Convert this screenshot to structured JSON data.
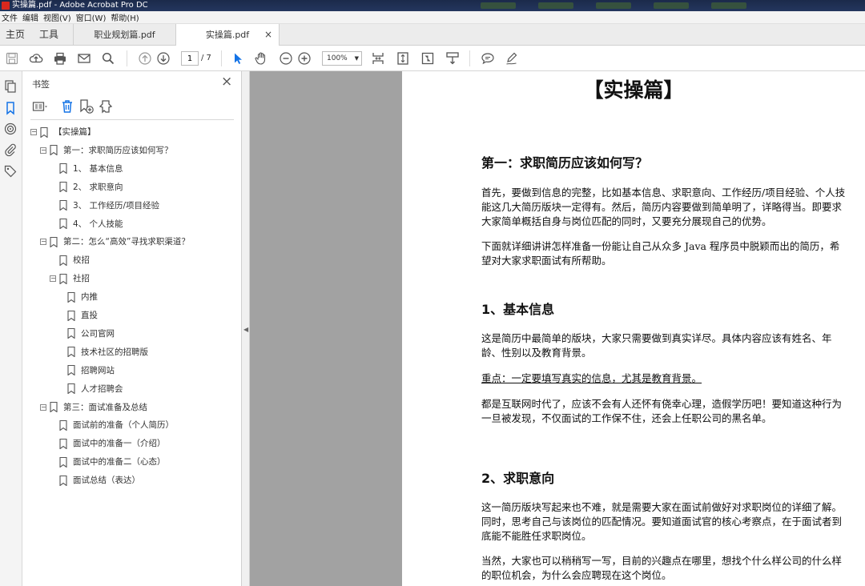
{
  "window": {
    "title": "实操篇.pdf - Adobe Acrobat Pro DC"
  },
  "menu": [
    "文件",
    "编辑",
    "视图(V)",
    "窗口(W)",
    "帮助(H)"
  ],
  "tabs": {
    "home": "主页",
    "tools": "工具",
    "documents": [
      {
        "label": "职业规划篇.pdf",
        "active": false
      },
      {
        "label": "实操篇.pdf",
        "active": true
      }
    ],
    "close": "×"
  },
  "toolbar": {
    "page_current": "1",
    "page_total": "/ 7",
    "zoom": "100%",
    "icons": [
      "save-icon",
      "upload-icon",
      "print-icon",
      "mail-icon",
      "search-icon",
      "page-up-icon",
      "page-down-icon",
      "select-cursor-icon",
      "hand-icon",
      "zoom-out-icon",
      "zoom-in-icon",
      "fit-width-icon",
      "fit-page-icon",
      "full-screen-icon",
      "scroll-mode-icon",
      "comment-icon",
      "pen-icon"
    ]
  },
  "bookmarks": {
    "title": "书签",
    "close": "×",
    "items": [
      {
        "label": "【实操篇】",
        "level": 0,
        "toggle": "−"
      },
      {
        "label": "第一：求职简历应该如何写？",
        "level": 1,
        "toggle": "−"
      },
      {
        "label": "1、 基本信息",
        "level": 2,
        "toggle": ""
      },
      {
        "label": "2、 求职意向",
        "level": 2,
        "toggle": ""
      },
      {
        "label": "3、 工作经历/项目经验",
        "level": 2,
        "toggle": ""
      },
      {
        "label": "4、 个人技能",
        "level": 2,
        "toggle": ""
      },
      {
        "label": "第二：怎么“高效”寻找求职渠道？",
        "level": 1,
        "toggle": "−"
      },
      {
        "label": "校招",
        "level": 2,
        "toggle": ""
      },
      {
        "label": "社招",
        "level": 2,
        "toggle": "−"
      },
      {
        "label": "内推",
        "level": 3,
        "toggle": ""
      },
      {
        "label": "直投",
        "level": 3,
        "toggle": ""
      },
      {
        "label": "公司官网",
        "level": 3,
        "toggle": ""
      },
      {
        "label": "技术社区的招聘版",
        "level": 3,
        "toggle": ""
      },
      {
        "label": "招聘网站",
        "level": 3,
        "toggle": ""
      },
      {
        "label": "人才招聘会",
        "level": 3,
        "toggle": ""
      },
      {
        "label": "第三：面试准备及总结",
        "level": 1,
        "toggle": "−"
      },
      {
        "label": "面试前的准备（个人简历）",
        "level": 2,
        "toggle": ""
      },
      {
        "label": "面试中的准备一（介绍）",
        "level": 2,
        "toggle": ""
      },
      {
        "label": "面试中的准备二（心态）",
        "level": 2,
        "toggle": ""
      },
      {
        "label": "面试总结（表达）",
        "level": 2,
        "toggle": ""
      }
    ]
  },
  "document": {
    "title": "【实操篇】",
    "h_section1": "第一：求职简历应该如何写？",
    "p1": "首先，要做到信息的完整，比如基本信息、求职意向、工作经历/项目经验、个人技能这几大简历版块一定得有。然后，简历内容要做到简单明了，详略得当。即要求大家简单概括自身与岗位匹配的同时，又要充分展现自己的优势。",
    "p2": "下面就详细讲讲怎样准备一份能让自己从众多 Java 程序员中脱颖而出的简历，希望对大家求职面试有所帮助。",
    "h_basic": "1、基本信息",
    "p3": "这是简历中最简单的版块，大家只需要做到真实详尽。具体内容应该有姓名、年龄、性别以及教育背景。",
    "p4": "重点：一定要填写真实的信息，尤其是教育背景。",
    "p5": "都是互联网时代了，应该不会有人还怀有侥幸心理，造假学历吧！要知道这种行为一旦被发现，不仅面试的工作保不住，还会上任职公司的黑名单。",
    "h_intent": "2、求职意向",
    "p6": "这一简历版块写起来也不难，就是需要大家在面试前做好对求职岗位的详细了解。同时，思考自己与该岗位的匹配情况。要知道面试官的核心考察点，在于面试者到底能不能胜任求职岗位。",
    "p7": "当然，大家也可以稍稍写一写，目前的兴趣点在哪里，想找个什么样公司的什么样的职位机会，为什么会应聘现在这个岗位。"
  }
}
